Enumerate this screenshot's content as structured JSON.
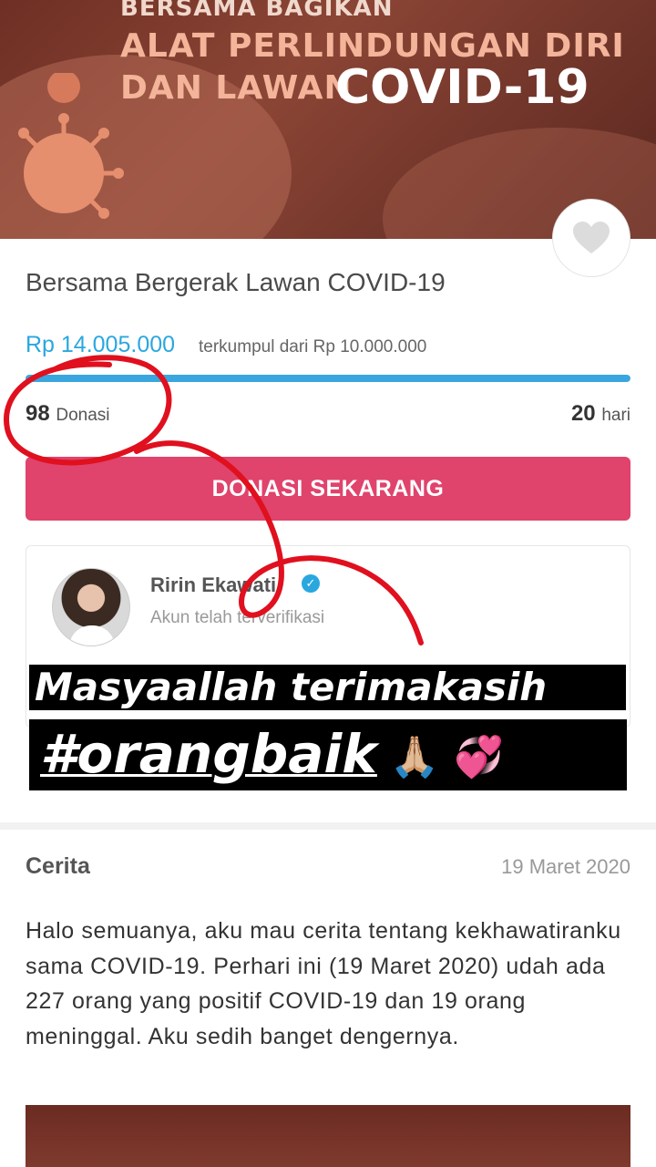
{
  "banner": {
    "line1": "BERSAMA BAGIKAN",
    "line2": "ALAT PERLINDUNGAN DIRI",
    "line3": "DAN LAWAN",
    "line4": "COVID-19"
  },
  "campaign": {
    "title": "Bersama Bergerak Lawan COVID-19",
    "raised_amount": "Rp 14.005.000",
    "raised_suffix": "terkumpul dari Rp 10.000.000",
    "progress_percent": 100,
    "donation_count": "98",
    "donation_label": "Donasi",
    "days_count": "20",
    "days_label": "hari",
    "cta_label": "DONASI SEKARANG"
  },
  "organizer": {
    "name": "Ririn Ekawati",
    "status": "Akun telah terverifikasi"
  },
  "overlay": {
    "line1": "Masyaallah terimakasih",
    "hashtag": "#orangbaik",
    "emoji": "🙏🏼 💞"
  },
  "story": {
    "heading": "Cerita",
    "date": "19 Maret 2020",
    "body": "Halo semuanya, aku  mau cerita tentang kekhawatiranku sama COVID-19. Perhari ini (19 Maret 2020) udah ada 227 orang yang positif COVID-19 dan 19 orang meninggal. Aku sedih banget dengernya."
  },
  "colors": {
    "accent_blue": "#2aa7df",
    "cta_pink": "#e0436c",
    "banner_brown": "#6e2f24",
    "scribble_red": "#e0101e"
  },
  "icons": {
    "favorite": "heart-icon",
    "verified": "verified-check-icon"
  }
}
